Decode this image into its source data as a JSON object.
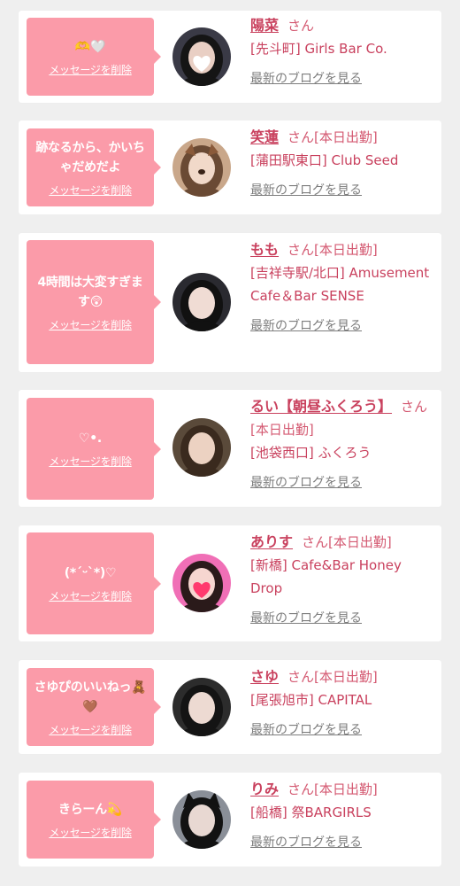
{
  "delete_label": "メッセージを削除",
  "blog_label": "最新のブログを見る",
  "san_label": "さん",
  "colors": {
    "bubble": "#fb9ba9",
    "accent_text": "#c9415e",
    "link_gray": "#7d7d7d",
    "card": "#ffffff",
    "page": "#efefef"
  },
  "messages": [
    {
      "message": "🫶🤍",
      "name": "陽菜",
      "status": "",
      "shop": "[先斗町] Girls Bar Co.",
      "avatar_icon": "photo-heart-icon"
    },
    {
      "message": "跡なるから、かいちゃだめだよ",
      "name": "笑蓮",
      "status": "[本日出勤]",
      "shop": "[蒲田駅東口] Club Seed",
      "avatar_icon": "photo-dog-filter-icon"
    },
    {
      "message": "4時間は大変すぎます😲",
      "name": "もも",
      "status": "[本日出勤]",
      "shop": "[吉祥寺駅/北口] Amusement Cafe＆Bar SENSE",
      "avatar_icon": "photo-icon"
    },
    {
      "message": "♡•.",
      "name": "るい【朝昼ふくろう】",
      "status": "[本日出勤]",
      "shop": "[池袋西口] ふくろう",
      "avatar_icon": "photo-icon"
    },
    {
      "message": "(*ˊᵕˋ*)♡",
      "name": "ありす",
      "status": "[本日出勤]",
      "shop": "[新橋] Cafe&Bar Honey Drop",
      "avatar_icon": "photo-heart-icon"
    },
    {
      "message": "さゆぴのいいねっ🧸🤎",
      "name": "さゆ",
      "status": "[本日出勤]",
      "shop": "[尾張旭市] CAPITAL",
      "avatar_icon": "photo-icon"
    },
    {
      "message": "きらーん💫",
      "name": "りみ",
      "status": "[本日出勤]",
      "shop": "[船橋] 祭BARGIRLS",
      "avatar_icon": "photo-cat-ears-icon"
    }
  ]
}
